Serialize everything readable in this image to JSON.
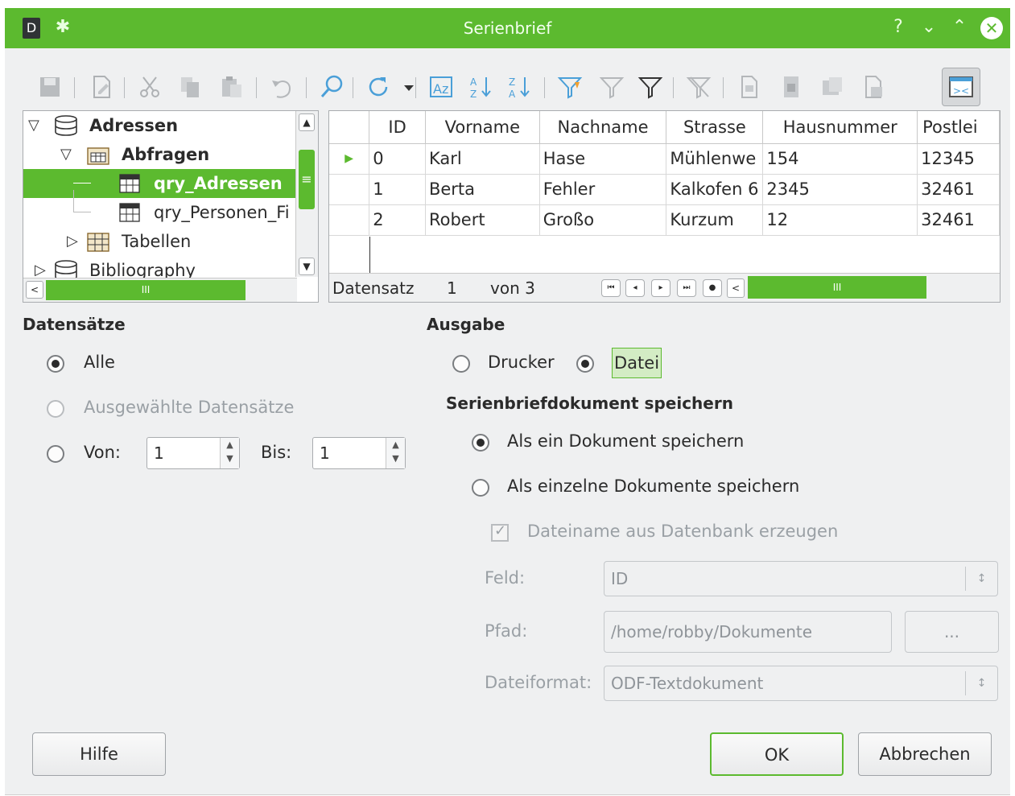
{
  "window": {
    "title": "Serienbrief"
  },
  "tree": {
    "items": [
      {
        "label": "Adressen",
        "bold": true
      },
      {
        "label": "Abfragen",
        "bold": true
      },
      {
        "label": "qry_Adressen",
        "selected": true
      },
      {
        "label": "qry_Personen_Fi"
      },
      {
        "label": "Tabellen"
      },
      {
        "label": "Bibliography"
      }
    ],
    "hscroll_grip": "III",
    "vscroll_grip": "≡"
  },
  "grid": {
    "columns": [
      "ID",
      "Vorname",
      "Nachname",
      "Strasse",
      "Hausnummer",
      "Postlei"
    ],
    "rows": [
      [
        "0",
        "Karl",
        "Hase",
        "Mühlenwe",
        "154",
        "12345"
      ],
      [
        "1",
        "Berta",
        "Fehler",
        "Kalkofen 6",
        "2345",
        "32461"
      ],
      [
        "2",
        "Robert",
        "Großo",
        "Kurzum",
        "12",
        "32461"
      ]
    ],
    "footer": {
      "label": "Datensatz",
      "current": "1",
      "of_label": "von 3",
      "hscroll_grip": "III"
    }
  },
  "records": {
    "heading": "Datensätze",
    "all_label": "Alle",
    "selected_label": "Ausgewählte Datensätze",
    "from_label": "Von:",
    "from_value": "1",
    "to_label": "Bis:",
    "to_value": "1"
  },
  "output": {
    "heading": "Ausgabe",
    "printer_label": "Drucker",
    "file_label": "Datei",
    "save_heading": "Serienbriefdokument speichern",
    "one_doc_label": "Als ein Dokument speichern",
    "single_docs_label": "Als einzelne Dokumente speichern",
    "filename_from_db_label": "Dateiname aus Datenbank erzeugen",
    "field_label": "Feld:",
    "field_value": "ID",
    "path_label": "Pfad:",
    "path_value": "/home/robby/Dokumente",
    "browse_label": "...",
    "format_label": "Dateiformat:",
    "format_value": "ODF-Textdokument"
  },
  "buttons": {
    "help": "Hilfe",
    "ok": "OK",
    "cancel": "Abbrechen"
  },
  "colors": {
    "accent": "#5cba2f",
    "window_bg": "#eff0f1"
  }
}
